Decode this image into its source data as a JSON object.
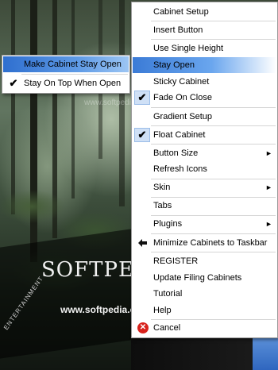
{
  "background": {
    "brand_text": "SOFTPEDIA",
    "brand_url": "www.softpedia.com",
    "vertical_text": "ENTERTAINMENT",
    "watermark": "www.softpedia.com"
  },
  "submenu": {
    "items": [
      {
        "label": "Make Cabinet Stay Open",
        "checked": false,
        "highlighted": true
      },
      {
        "label": "Stay On Top When Open",
        "checked": true,
        "highlighted": false
      }
    ]
  },
  "menu": {
    "items": [
      {
        "label": "Cabinet Setup"
      },
      {
        "label": "Insert Button"
      },
      {
        "label": "Use Single Height"
      },
      {
        "label": "Stay Open",
        "highlighted": true
      },
      {
        "label": "Sticky Cabinet"
      },
      {
        "label": "Fade On Close",
        "checked": true
      },
      {
        "label": "Gradient Setup"
      },
      {
        "label": "Float Cabinet",
        "checked": true
      },
      {
        "label": "Button Size",
        "submenu": true
      },
      {
        "label": "Refresh Icons"
      },
      {
        "label": "Skin",
        "submenu": true
      },
      {
        "label": "Tabs"
      },
      {
        "label": "Plugins",
        "submenu": true
      },
      {
        "label": "Minimize Cabinets to Taskbar",
        "icon": "minimize-to-taskbar-icon"
      },
      {
        "label": "REGISTER"
      },
      {
        "label": "Update Filing Cabinets"
      },
      {
        "label": "Tutorial"
      },
      {
        "label": "Help"
      },
      {
        "label": "Cancel",
        "icon": "cancel-icon"
      }
    ],
    "checkmark_glyph": "✔",
    "submenu_arrow_glyph": "►",
    "cancel_glyph": "✕"
  },
  "colors": {
    "highlight_start": "#3b7bd6",
    "highlight_end": "#ffffff",
    "cancel_icon": "#d8221c"
  }
}
